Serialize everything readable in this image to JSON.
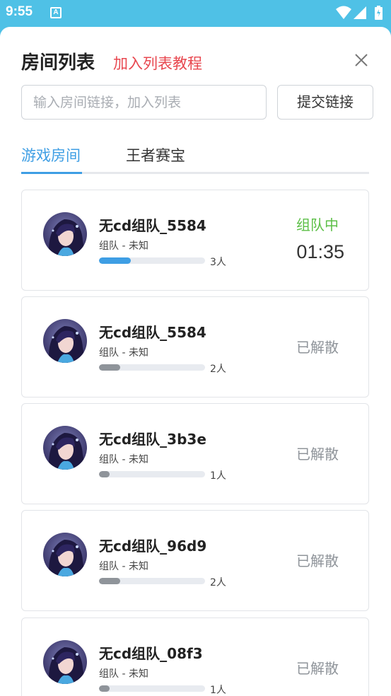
{
  "status_bar": {
    "time": "9:55",
    "notification_glyph": "A"
  },
  "header": {
    "title": "房间列表",
    "tutorial_link": "加入列表教程"
  },
  "search": {
    "placeholder": "输入房间链接，加入列表",
    "value": ""
  },
  "submit_label": "提交链接",
  "tabs": [
    {
      "label": "游戏房间",
      "active": true
    },
    {
      "label": "王者赛宝",
      "active": false
    }
  ],
  "colors": {
    "accent": "#3e9ee4",
    "active_status": "#5cbf47",
    "disbanded_status": "#8f949a",
    "bar_active": "#3e9ee4",
    "bar_inactive": "#8f949a",
    "tutorial": "#e8474f"
  },
  "rooms": [
    {
      "name": "无cd组队_5584",
      "subtitle": "组队 - 未知",
      "count": "3人",
      "fill": 0.3,
      "status": "组队中",
      "timer": "01:35",
      "active": true
    },
    {
      "name": "无cd组队_5584",
      "subtitle": "组队 - 未知",
      "count": "2人",
      "fill": 0.2,
      "status": "已解散",
      "timer": "",
      "active": false
    },
    {
      "name": "无cd组队_3b3e",
      "subtitle": "组队 - 未知",
      "count": "1人",
      "fill": 0.1,
      "status": "已解散",
      "timer": "",
      "active": false
    },
    {
      "name": "无cd组队_96d9",
      "subtitle": "组队 - 未知",
      "count": "2人",
      "fill": 0.2,
      "status": "已解散",
      "timer": "",
      "active": false
    },
    {
      "name": "无cd组队_08f3",
      "subtitle": "组队 - 未知",
      "count": "1人",
      "fill": 0.1,
      "status": "已解散",
      "timer": "",
      "active": false
    }
  ]
}
